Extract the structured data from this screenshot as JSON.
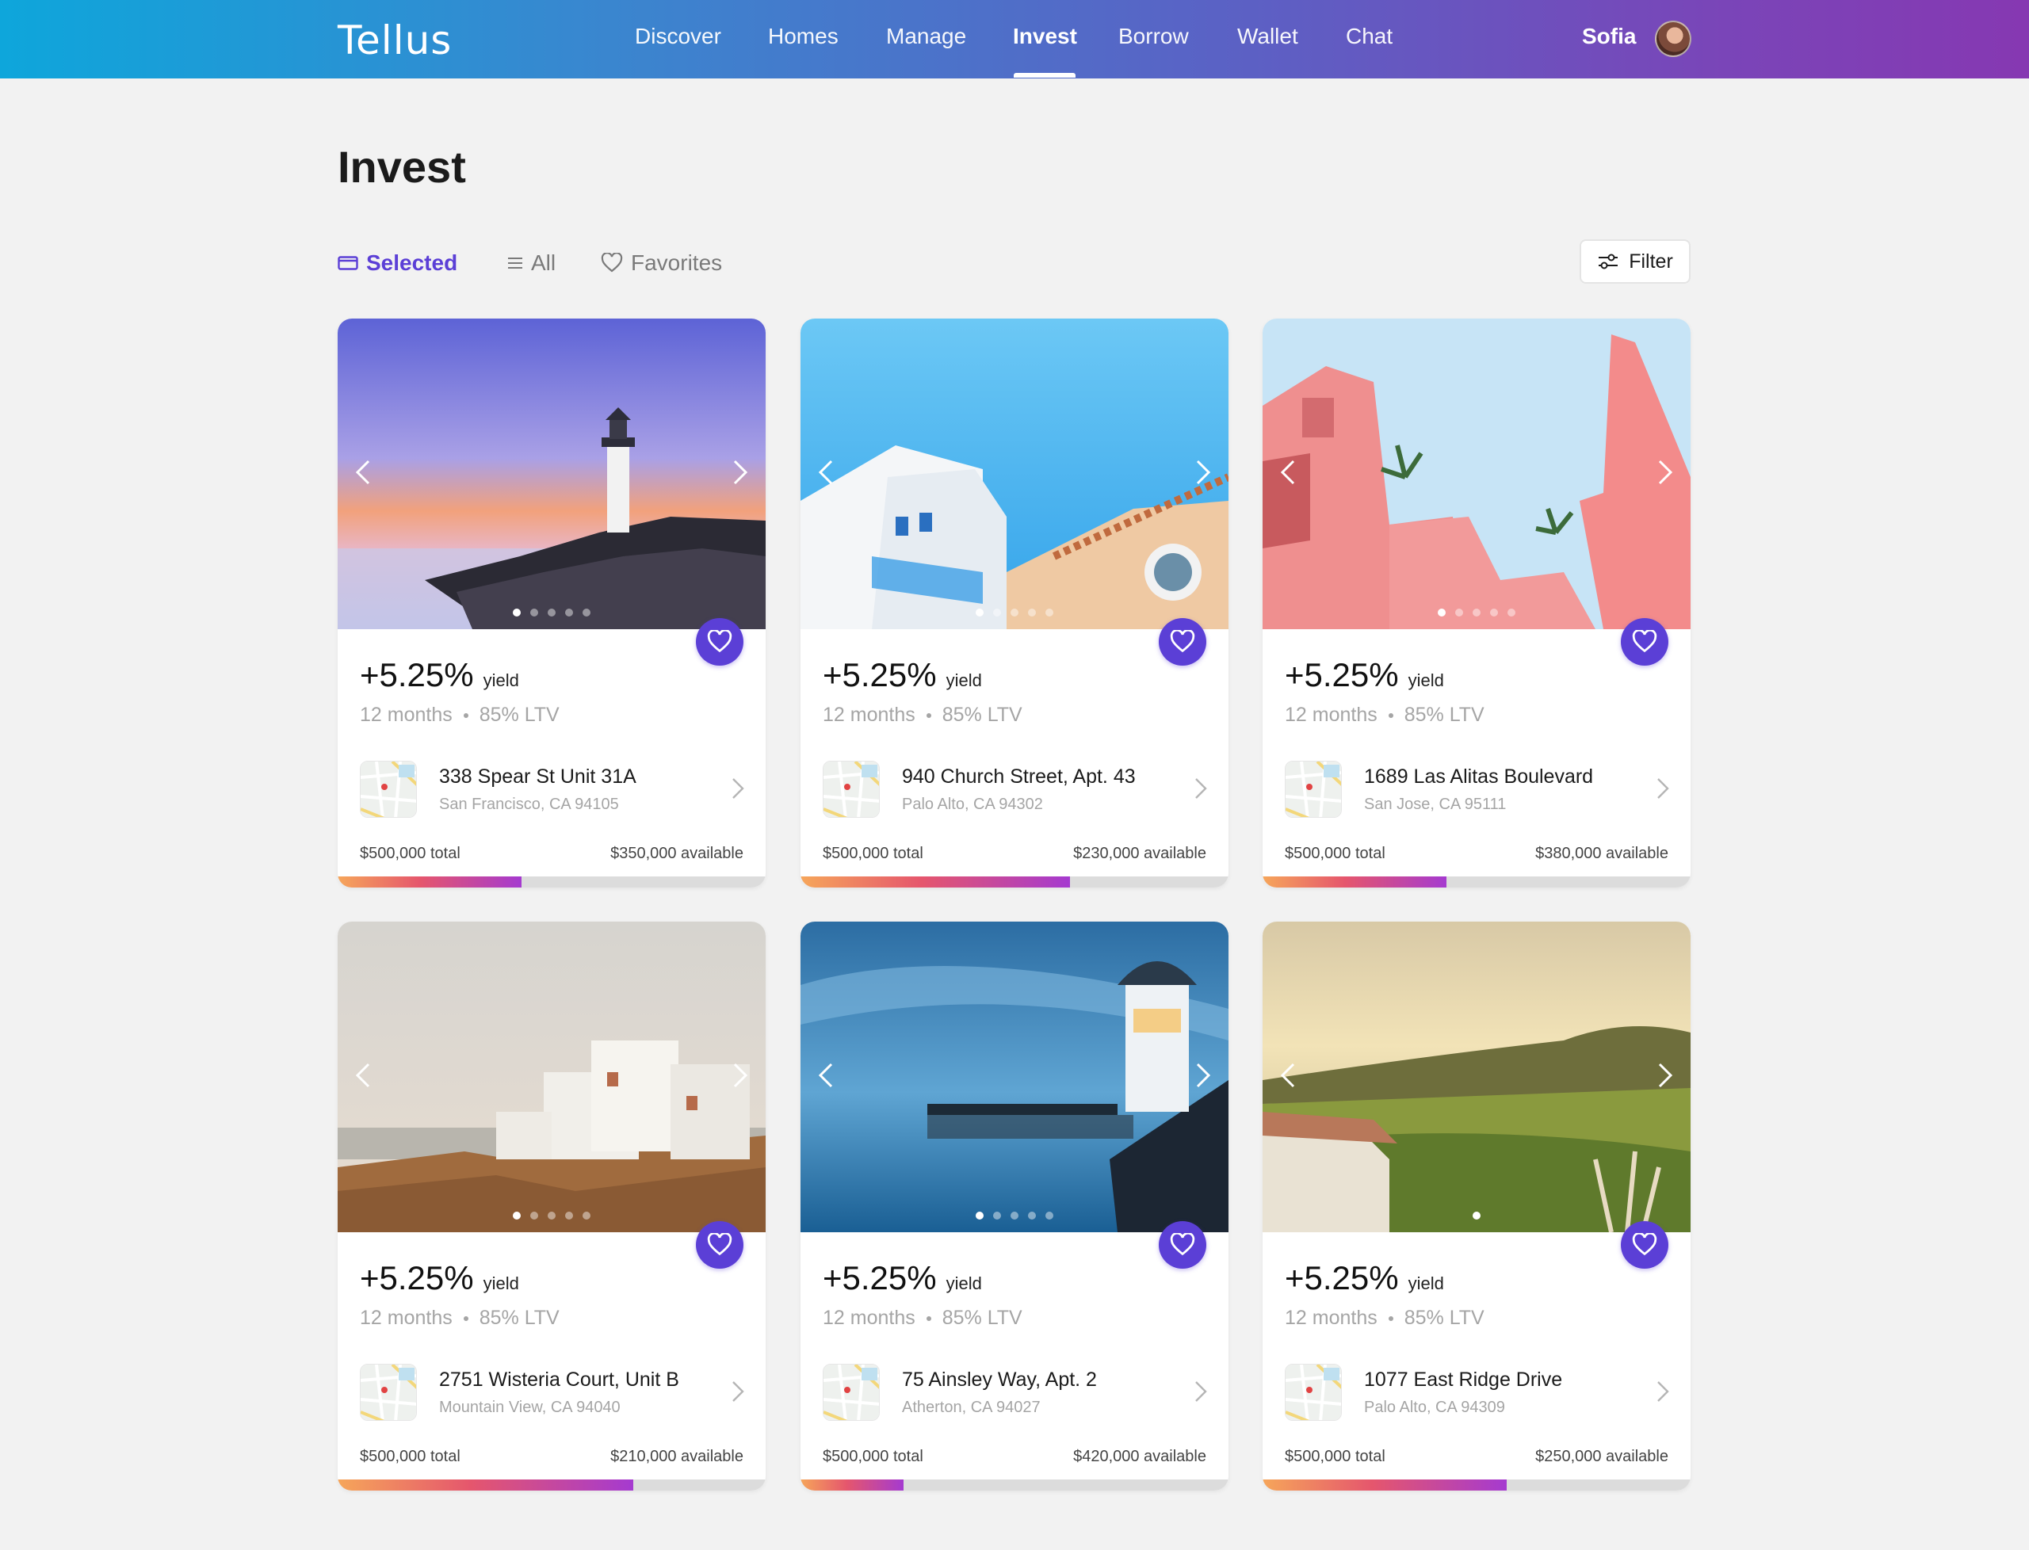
{
  "app": {
    "logo": "Tellus"
  },
  "nav": {
    "items": [
      "Discover",
      "Homes",
      "Manage",
      "Invest",
      "Borrow",
      "Wallet",
      "Chat"
    ],
    "active": "Invest"
  },
  "user": {
    "name": "Sofia"
  },
  "page": {
    "title": "Invest"
  },
  "tabs": [
    {
      "label": "Selected",
      "icon": "card-icon",
      "active": true
    },
    {
      "label": "All",
      "icon": "list-icon",
      "active": false
    },
    {
      "label": "Favorites",
      "icon": "heart-outline-icon",
      "active": false
    }
  ],
  "filter": {
    "label": "Filter",
    "icon": "sliders-icon"
  },
  "accent": "#5b3fd6",
  "cards": [
    {
      "yield": "+5.25%",
      "yield_label": "yield",
      "term": "12 months",
      "ltv": "85% LTV",
      "address": "338 Spear St Unit 31A",
      "city": "San Francisco, CA 94105",
      "total": "$500,000 total",
      "available": "$350,000 available",
      "funded_fraction": 0.43,
      "photo": "lighthouse",
      "active_dot": 0,
      "dot_count": 5
    },
    {
      "yield": "+5.25%",
      "yield_label": "yield",
      "term": "12 months",
      "ltv": "85% LTV",
      "address": "940 Church Street, Apt. 43",
      "city": "Palo Alto, CA 94302",
      "total": "$500,000 total",
      "available": "$230,000 available",
      "funded_fraction": 0.63,
      "photo": "white-house",
      "active_dot": 0,
      "dot_count": 5
    },
    {
      "yield": "+5.25%",
      "yield_label": "yield",
      "term": "12 months",
      "ltv": "85% LTV",
      "address": "1689 Las Alitas Boulevard",
      "city": "San Jose, CA 95111",
      "total": "$500,000 total",
      "available": "$380,000 available",
      "funded_fraction": 0.43,
      "photo": "pink-building",
      "active_dot": 0,
      "dot_count": 5
    },
    {
      "yield": "+5.25%",
      "yield_label": "yield",
      "term": "12 months",
      "ltv": "85% LTV",
      "address": "2751 Wisteria Court, Unit B",
      "city": "Mountain View, CA 94040",
      "total": "$500,000 total",
      "available": "$210,000 available",
      "funded_fraction": 0.69,
      "photo": "coastal-village",
      "active_dot": 0,
      "dot_count": 5
    },
    {
      "yield": "+5.25%",
      "yield_label": "yield",
      "term": "12 months",
      "ltv": "85% LTV",
      "address": "75 Ainsley Way, Apt. 2",
      "city": "Atherton, CA 94027",
      "total": "$500,000 total",
      "available": "$420,000 available",
      "funded_fraction": 0.24,
      "photo": "pier",
      "active_dot": 0,
      "dot_count": 5
    },
    {
      "yield": "+5.25%",
      "yield_label": "yield",
      "term": "12 months",
      "ltv": "85% LTV",
      "address": "1077 East Ridge Drive",
      "city": "Palo Alto, CA 94309",
      "total": "$500,000 total",
      "available": "$250,000 available",
      "funded_fraction": 0.57,
      "photo": "countryside",
      "active_dot": 0,
      "dot_count": 1
    }
  ]
}
